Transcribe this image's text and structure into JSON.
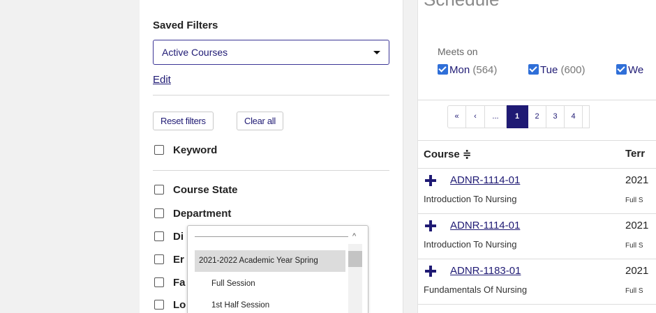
{
  "filters": {
    "saved_title": "Saved Filters",
    "selected": "Active Courses",
    "edit_label": "Edit",
    "reset_label": "Reset filters",
    "clear_label": "Clear all",
    "keyword_label": "Keyword",
    "facets": [
      "Course State",
      "Department",
      "Di",
      "Er",
      "Fa",
      "Lo"
    ]
  },
  "term_dropdown": {
    "items": [
      "2021-2022 Academic Year Spring",
      "Full Session",
      "1st Half Session"
    ]
  },
  "schedule": {
    "title": "Schedule",
    "meets_label": "Meets on",
    "days": [
      {
        "label": "Mon",
        "count": "(564)"
      },
      {
        "label": "Tue",
        "count": "(600)"
      },
      {
        "label": "We",
        "count": ""
      }
    ]
  },
  "pagination": {
    "items": [
      "«",
      "‹",
      "...",
      "1",
      "2",
      "3",
      "4"
    ],
    "current": "1"
  },
  "table": {
    "col_course": "Course ≑",
    "col_term": "Terr",
    "rows": [
      {
        "code": "ADNR-1114-01",
        "name": "Introduction To Nursing",
        "term": "2021",
        "session": "Full S"
      },
      {
        "code": "ADNR-1114-01",
        "name": "Introduction To Nursing",
        "term": "2021",
        "session": "Full S"
      },
      {
        "code": "ADNR-1183-01",
        "name": "Fundamentals Of Nursing",
        "term": "2021",
        "session": "Full S"
      }
    ]
  },
  "colors": {
    "accent": "#1f1a74",
    "checkbox": "#2f6fd8"
  }
}
